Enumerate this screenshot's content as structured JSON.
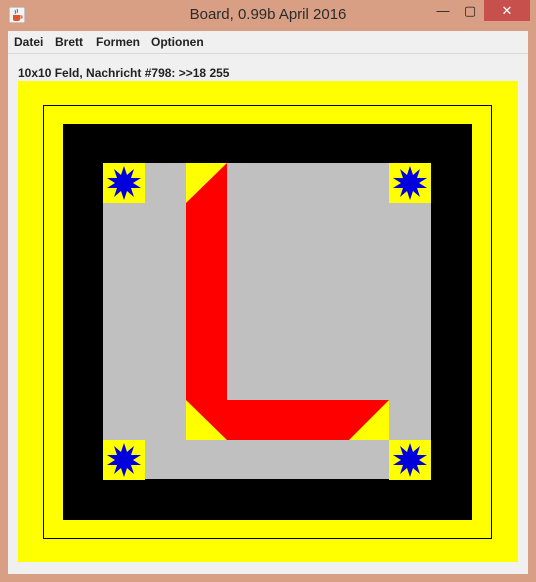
{
  "window": {
    "title": "Board, 0.99b April 2016",
    "app_icon": "java-cup-icon",
    "controls": {
      "minimize": "—",
      "maximize": "▢",
      "close": "✕"
    }
  },
  "menubar": {
    "items": [
      "Datei",
      "Brett",
      "Formen",
      "Optionen"
    ]
  },
  "status": {
    "message": "10x10 Feld, Nachricht #798: >>18 255"
  },
  "board": {
    "size": "10x10",
    "colors": {
      "background": "#ffff00",
      "frame": "#000000",
      "field": "#c0c0c0",
      "l_shape": "#ff0000",
      "corner_tile": "#ffff00",
      "star": "#0000dd"
    },
    "corner_stars": [
      "top-left",
      "top-right",
      "bottom-left",
      "bottom-right"
    ],
    "shape": "L"
  }
}
